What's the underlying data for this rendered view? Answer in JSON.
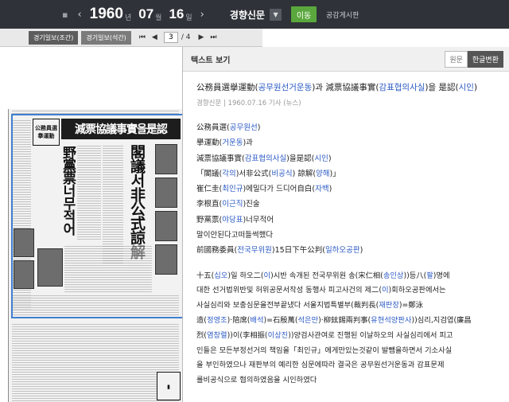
{
  "topbar": {
    "prev_label": "‹",
    "year": "1960",
    "year_unit": "년",
    "month": "07",
    "month_unit": "월",
    "day": "16",
    "day_unit": "일",
    "next_label": "›",
    "newspaper": "경향신문",
    "go_label": "이동",
    "notice_label": "공감게시판"
  },
  "viewer_bar": {
    "editions": [
      "경기일보(조간)",
      "경기일보(석간)"
    ],
    "current_page": "3",
    "total_pages": "/ 4"
  },
  "newspaper_page": {
    "headline_main": "減票協議事實을是認",
    "headline_sub1": "閣議서非公式諒解",
    "headline_sub2": "野黨票너무적어",
    "headline_small": "公務員選擧運動"
  },
  "text_panel": {
    "title": "텍스트 보기",
    "tab_original": "원문",
    "tab_korean": "한글변환",
    "headline_segments": [
      {
        "t": "公務員選擧運動(",
        "blue": false
      },
      {
        "t": "공무원선거운동",
        "blue": true
      },
      {
        "t": ")과 減票協議事實(",
        "blue": false
      },
      {
        "t": "감표협의사실",
        "blue": true
      },
      {
        "t": ")을 是認(",
        "blue": false
      },
      {
        "t": "시인",
        "blue": true
      },
      {
        "t": ")",
        "blue": false
      }
    ],
    "meta": "경향신문 | 1960.07.16 기사 (뉴스)",
    "lines": [
      [
        {
          "t": "公務員選(",
          "blue": false
        },
        {
          "t": "공무원선",
          "blue": true
        },
        {
          "t": ")",
          "blue": false
        }
      ],
      [
        {
          "t": "擧運動(",
          "blue": false
        },
        {
          "t": "거운동",
          "blue": true
        },
        {
          "t": ")과",
          "blue": false
        }
      ],
      [
        {
          "t": "減票協議事實(",
          "blue": false
        },
        {
          "t": "감표협의사실",
          "blue": true
        },
        {
          "t": ")을是認(",
          "blue": false
        },
        {
          "t": "시인",
          "blue": true
        },
        {
          "t": ")",
          "blue": false
        }
      ],
      [
        {
          "t": "「閣議(",
          "blue": false
        },
        {
          "t": "각의",
          "blue": true
        },
        {
          "t": ")서非公式(",
          "blue": false
        },
        {
          "t": "비공식",
          "blue": true
        },
        {
          "t": ") 諒解(",
          "blue": false
        },
        {
          "t": "양해",
          "blue": true
        },
        {
          "t": ")」",
          "blue": false
        }
      ],
      [
        {
          "t": "崔仁圭(",
          "blue": false
        },
        {
          "t": "최인규",
          "blue": true
        },
        {
          "t": ")에밀다가 드디어自白(",
          "blue": false
        },
        {
          "t": "자백",
          "blue": true
        },
        {
          "t": ")",
          "blue": false
        }
      ],
      [
        {
          "t": "李根直(",
          "blue": false
        },
        {
          "t": "이근직",
          "blue": true
        },
        {
          "t": ")진술",
          "blue": false
        }
      ],
      [
        {
          "t": "野黨票(",
          "blue": false
        },
        {
          "t": "야당표",
          "blue": true
        },
        {
          "t": ")너무적어",
          "blue": false
        }
      ],
      [
        {
          "t": "말이안된다고떠들썩했다",
          "blue": false
        }
      ],
      [
        {
          "t": "前國務委員(",
          "blue": false
        },
        {
          "t": "전국무위원",
          "blue": true
        },
        {
          "t": ")15日下午公判(",
          "blue": false
        },
        {
          "t": "일하오공판",
          "blue": true
        },
        {
          "t": ")",
          "blue": false
        }
      ]
    ],
    "body": [
      [
        {
          "t": "  十五(",
          "blue": false
        },
        {
          "t": "십오",
          "blue": true
        },
        {
          "t": ")일 하오二(",
          "blue": false
        },
        {
          "t": "이",
          "blue": true
        },
        {
          "t": ")시반 속개된 전국무위원 송(宋仁相(",
          "blue": false
        },
        {
          "t": "송인상",
          "blue": true
        },
        {
          "t": "))등八(",
          "blue": false
        },
        {
          "t": "팔",
          "blue": true
        },
        {
          "t": ")명에",
          "blue": false
        }
      ],
      [
        {
          "t": "대한 선거법위반및 허위공문서작성 동행사 피고사건의 제二(",
          "blue": false
        },
        {
          "t": "이",
          "blue": true
        },
        {
          "t": ")회하오공판에서는",
          "blue": false
        }
      ],
      [
        {
          "t": "사실심리와 보충심문을전부끝냈다 서울지법특별부(裁判長(",
          "blue": false
        },
        {
          "t": "재판장",
          "blue": true
        },
        {
          "t": ")=鄭泳",
          "blue": false
        }
      ],
      [
        {
          "t": "造(",
          "blue": false
        },
        {
          "t": "정영조",
          "blue": true
        },
        {
          "t": ")·陪席(",
          "blue": false
        },
        {
          "t": "배석",
          "blue": true
        },
        {
          "t": ")=石殷萬(",
          "blue": false
        },
        {
          "t": "석은만",
          "blue": true
        },
        {
          "t": ")·柳鉉錫兩判事(",
          "blue": false
        },
        {
          "t": "유현석양판사",
          "blue": true
        },
        {
          "t": "))심리,지검엽(廉昌",
          "blue": false
        }
      ],
      [
        {
          "t": "烈(",
          "blue": false
        },
        {
          "t": "염창렬",
          "blue": true
        },
        {
          "t": "))이(李相振(",
          "blue": false
        },
        {
          "t": "이상진",
          "blue": true
        },
        {
          "t": "))양검사관여로 진행된 이날하오의 사실심리에서 피고",
          "blue": false
        }
      ],
      [
        {
          "t": "인들은 모든부정선거의 책임을「최인규」에게만있는것같이 발뺌을하면서 기소사실",
          "blue": false
        }
      ],
      [
        {
          "t": "을 부인하였으나 재판부의 예리한 심문에따라 결국은 공무원선거운동과 감표문제",
          "blue": false
        }
      ],
      [
        {
          "t": "를비공식으로 협의하였음을 시인하였다",
          "blue": false
        }
      ]
    ]
  }
}
